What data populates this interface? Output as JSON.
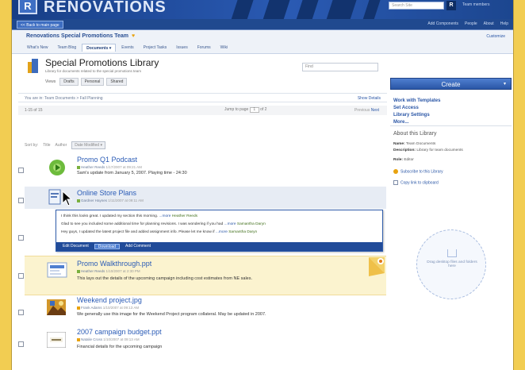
{
  "header": {
    "logo_letter": "R",
    "brand": "RENOVATIONS",
    "search_placeholder": "Search Site",
    "search_button": "R",
    "user": "Team members"
  },
  "navbar": {
    "back_label": "<< Back to main page",
    "links": [
      "Add Components",
      "People",
      "About",
      "Help"
    ]
  },
  "team": {
    "title": "Renovations Special Promotions Team",
    "heart": "♥",
    "customize": "Customize",
    "tabs": [
      "What's New",
      "Team Blog",
      "Documents ▾",
      "Events",
      "Project Tasks",
      "Issues",
      "Forums",
      "Wiki"
    ]
  },
  "library": {
    "title": "Special Promotions Library",
    "subtitle": "Library for documents related to the special promotions team",
    "find_placeholder": "Find",
    "views_label": "Views",
    "views": [
      "Drafts",
      "Personal",
      "Shared"
    ],
    "breadcrumb": "You are in: Team Documents > Fall Planning",
    "show_details": "Show Details",
    "count": "1-15 of 15",
    "jump_label": "Jump to page",
    "jump_value": "1",
    "jump_of": "of 2",
    "prev": "Previous",
    "next": "Next"
  },
  "sort": {
    "label": "Sort by:",
    "options": [
      "Title",
      "Author"
    ],
    "selected": "Date Modified ▾"
  },
  "documents": [
    {
      "title": "Promo Q1 Podcast",
      "author": "Heather Reeds",
      "date": "1/17/2007 at 09:21 AM",
      "desc": "Sam's update from January 5, 2007. Playing time - 24:30"
    },
    {
      "title": "Online Store Plans",
      "author": "Gardner Haynes",
      "date": "1/11/2007 at 09:11 AM",
      "desc": ""
    },
    {
      "title": "Promo Walkthrough.ppt",
      "author": "Heather Reeds",
      "date": "1/10/2007 at 2:30 PM",
      "desc": "This lays out the details of the upcoming campaign including cost estimates from NE sales."
    },
    {
      "title": "Weekend project.jpg",
      "author": "Frank Adams",
      "date": "1/10/2007 at 09:13 AM",
      "desc": "We generally use this image for the Weekend Project program collateral. May be updated in 2007."
    },
    {
      "title": "2007 campaign budget.ppt",
      "author": "Natalie Cross",
      "date": "1/10/2007 at 09:13 AM",
      "desc": "Financial details for the upcoming campaign"
    }
  ],
  "popup": {
    "comments": [
      {
        "text": "I think this looks great. I updated my section this morning.",
        "more": "...more",
        "author": "Heather Reeds"
      },
      {
        "text": "Glad to see you included some additional time for planning revisions. I was wondering if you had",
        "more": "...more",
        "author": "Samantha Daryn"
      },
      {
        "text": "Hey guys, I updated the latest project file and added assignment info. Please let me know if",
        "more": "...more",
        "author": "Samantha Daryn"
      }
    ],
    "actions": [
      "Edit Document",
      "Download",
      "Add Comment"
    ]
  },
  "sidebar": {
    "create": "Create",
    "create_arrow": "▾",
    "links": [
      "Work with Templates",
      "Set Access",
      "Library Settings",
      "More..."
    ],
    "about_title": "About this Library",
    "about_rows": [
      {
        "label": "Name:",
        "value": "Team Documents"
      },
      {
        "label": "Description:",
        "value": "Library for team documents"
      },
      {
        "label": "Role:",
        "value": "Editor"
      }
    ],
    "about_links": [
      "Subscribe to this Library",
      "Copy link to clipboard"
    ],
    "drop_text": "Drag desktop files and folders here"
  },
  "colors": {
    "background": "#f2cd52",
    "header": "#1c468f",
    "link": "#2a5bb6",
    "highlight": "#fbf3cf"
  }
}
